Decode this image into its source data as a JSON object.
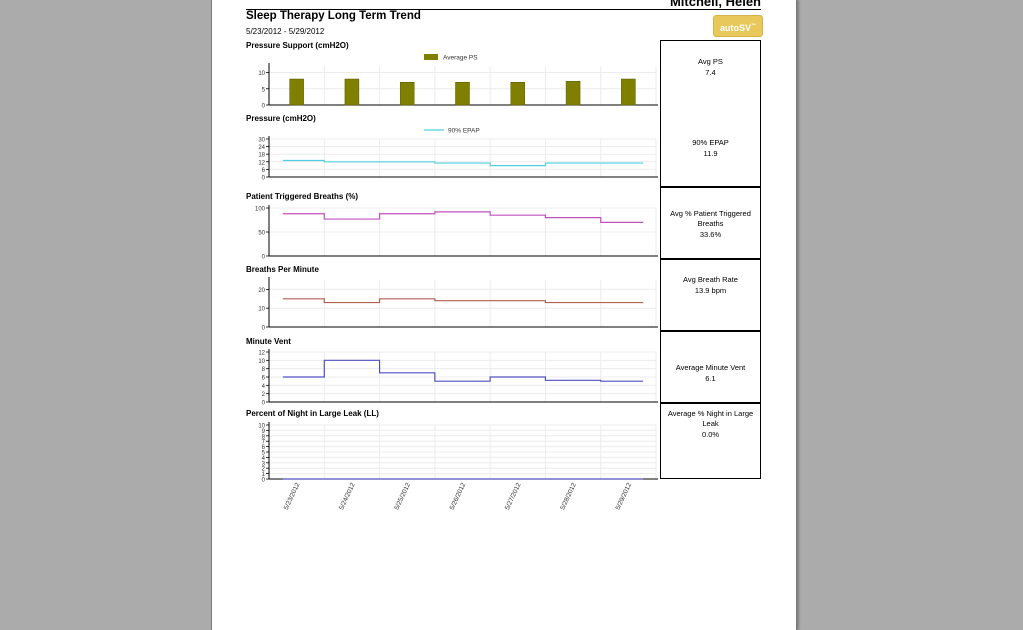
{
  "header": {
    "patient_name": "Mitchell, Helen",
    "report_title": "Sleep Therapy Long Term Trend",
    "date_range": "5/23/2012 - 5/29/2012",
    "device_badge": "autoSV",
    "badge_mark": "™"
  },
  "dates": [
    "5/23/2012",
    "5/24/2012",
    "5/25/2012",
    "5/26/2012",
    "5/27/2012",
    "5/28/2012",
    "5/29/2012"
  ],
  "summary": [
    {
      "label": "Avg PS",
      "value": "7.4"
    },
    {
      "label": "90% EPAP",
      "value": "11.9"
    },
    {
      "label": "Avg % Patient Triggered Breaths",
      "value": "33.6%"
    },
    {
      "label": "Avg Breath Rate",
      "value": "13.9 bpm"
    },
    {
      "label": "Average Minute Vent",
      "value": "6.1"
    },
    {
      "label": "Average % Night in Large Leak",
      "value": "0.0%"
    }
  ],
  "chart_data": [
    {
      "type": "bar",
      "title": "Pressure Support (cmH2O)",
      "legend": "Average PS",
      "legend_position": "top",
      "color": "#808000",
      "categories": [
        "5/23/2012",
        "5/24/2012",
        "5/25/2012",
        "5/26/2012",
        "5/27/2012",
        "5/28/2012",
        "5/29/2012"
      ],
      "values": [
        8,
        8,
        7,
        7,
        7,
        7.3,
        8
      ],
      "ylim": [
        0,
        12
      ],
      "yticks": [
        0,
        5,
        10
      ]
    },
    {
      "type": "line",
      "title": "Pressure (cmH2O)",
      "legend": "90% EPAP",
      "legend_position": "top",
      "color": "#50d0e0",
      "categories": [
        "5/23/2012",
        "5/24/2012",
        "5/25/2012",
        "5/26/2012",
        "5/27/2012",
        "5/28/2012",
        "5/29/2012"
      ],
      "values": [
        13,
        12,
        12,
        11,
        9,
        11,
        11
      ],
      "ylim": [
        0,
        30
      ],
      "yticks": [
        0,
        6,
        12,
        18,
        24,
        30
      ]
    },
    {
      "type": "line",
      "title": "Patient Triggered Breaths (%)",
      "color": "#c050c0",
      "categories": [
        "5/23/2012",
        "5/24/2012",
        "5/25/2012",
        "5/26/2012",
        "5/27/2012",
        "5/28/2012",
        "5/29/2012"
      ],
      "values": [
        88,
        77,
        88,
        92,
        85,
        80,
        70
      ],
      "ylim": [
        0,
        100
      ],
      "yticks": [
        0,
        50,
        100
      ]
    },
    {
      "type": "line",
      "title": "Breaths Per Minute",
      "color": "#b06050",
      "categories": [
        "5/23/2012",
        "5/24/2012",
        "5/25/2012",
        "5/26/2012",
        "5/27/2012",
        "5/28/2012",
        "5/29/2012"
      ],
      "values": [
        15,
        13,
        15,
        14,
        14,
        13,
        13
      ],
      "ylim": [
        0,
        25
      ],
      "yticks": [
        0,
        10,
        20
      ]
    },
    {
      "type": "line",
      "title": "Minute Vent",
      "color": "#5050c0",
      "categories": [
        "5/23/2012",
        "5/24/2012",
        "5/25/2012",
        "5/26/2012",
        "5/27/2012",
        "5/28/2012",
        "5/29/2012"
      ],
      "values": [
        6,
        10,
        7,
        5,
        6,
        5.2,
        5
      ],
      "ylim": [
        0,
        12
      ],
      "yticks": [
        0,
        2,
        4,
        6,
        8,
        10,
        12
      ]
    },
    {
      "type": "line",
      "title": "Percent of Night in Large Leak (LL)",
      "color": "#5050c0",
      "categories": [
        "5/23/2012",
        "5/24/2012",
        "5/25/2012",
        "5/26/2012",
        "5/27/2012",
        "5/28/2012",
        "5/29/2012"
      ],
      "values": [
        0,
        0,
        0,
        0,
        0,
        0,
        0
      ],
      "ylim": [
        0,
        10
      ],
      "yticks": [
        0,
        1,
        2,
        3,
        4,
        5,
        6,
        7,
        8,
        9,
        10
      ]
    }
  ]
}
